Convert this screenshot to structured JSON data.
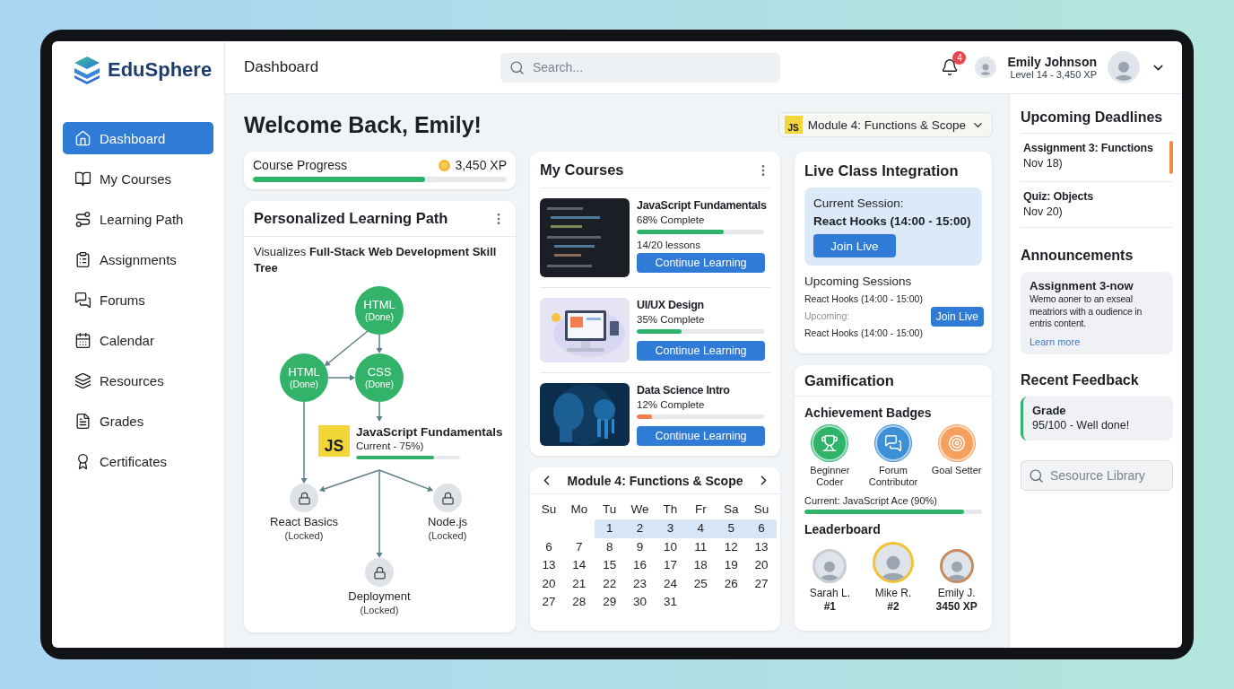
{
  "sidebar": {
    "logo": "EduSphere",
    "items": [
      {
        "label": "Dashboard",
        "selected": true
      },
      {
        "label": "My Courses",
        "selected": false
      },
      {
        "label": "Learning Path",
        "selected": false
      },
      {
        "label": "Assignments",
        "selected": false
      },
      {
        "label": "Forums",
        "selected": false
      },
      {
        "label": "Calendar",
        "selected": false
      },
      {
        "label": "Resources",
        "selected": false
      },
      {
        "label": "Grades",
        "selected": false
      },
      {
        "label": "Certificates",
        "selected": false
      }
    ]
  },
  "topbar": {
    "title": "Dashboard",
    "search": {
      "placeholder": "Search..."
    },
    "notifications": "4",
    "user": {
      "name": "Emily Johnson",
      "level": "Level 14 - 3,450 XP"
    }
  },
  "welcome": "Welcome Back, Emily!",
  "module_selector": {
    "badge": "JS",
    "label": "Module 4: Functions & Scope"
  },
  "course_progress": {
    "label": "Course Progress",
    "xp": "3,450 XP",
    "level": 0.68
  },
  "learning_path": {
    "title": "Personalized Learning Path",
    "description": "Visualizes **Full-Stack Web Development Skill Tree**",
    "nodes": [
      {
        "kind": "done",
        "label": "HTML",
        "status": "(Done)"
      },
      {
        "kind": "done",
        "label": "HTML",
        "status": "(Done)"
      },
      {
        "kind": "done",
        "label": "CSS",
        "status": "(Done)"
      },
      {
        "kind": "current",
        "badge": "JS",
        "label": "JavaScript Fundamentals",
        "status": "Current - 75%)",
        "level": 0.75
      },
      {
        "kind": "locked",
        "label": "React Basics",
        "status": "(Locked)"
      },
      {
        "kind": "locked",
        "label": "Node.js",
        "status": "(Locked)"
      },
      {
        "kind": "locked",
        "label": "Deployment",
        "status": "(Locked)"
      }
    ]
  },
  "my_courses": {
    "title": "My Courses",
    "courses": [
      {
        "title": "JavaScript Fundamentals",
        "progress": "68% Complete",
        "level": 0.68,
        "color": "#2fb36b",
        "lessons": "14/20 lessons",
        "button": "Continue Learning"
      },
      {
        "title": "UI/UX Design",
        "progress": "35% Complete",
        "level": 0.35,
        "color": "#2fb36b",
        "button": "Continue Learning"
      },
      {
        "title": "Data Science Intro",
        "progress": "12% Complete",
        "level": 0.12,
        "color": "#f07f4f",
        "button": "Continue Learning"
      }
    ]
  },
  "calendar": {
    "title": "Module 4: Functions & Scope",
    "weekdays": [
      "Su",
      "Mo",
      "Tu",
      "We",
      "Th",
      "Fr",
      "Sa",
      "Su"
    ],
    "weeks": [
      {
        "days": [
          "1",
          "2",
          "3",
          "4",
          "5",
          "6"
        ],
        "selected": true
      },
      {
        "days": [
          "6",
          "7",
          "8",
          "9",
          "10",
          "11",
          "12",
          "13"
        ],
        "selected": false
      },
      {
        "days": [
          "13",
          "14",
          "15",
          "16",
          "17",
          "18",
          "19",
          "20"
        ],
        "selected": false
      },
      {
        "days": [
          "20",
          "21",
          "22",
          "23",
          "24",
          "25",
          "26",
          "27"
        ],
        "selected": false
      },
      {
        "days": [
          "27",
          "28",
          "29",
          "30",
          "31"
        ],
        "selected": false
      }
    ]
  },
  "live_class": {
    "title": "Live Class Integration",
    "current": {
      "label": "Current Session:",
      "session": "React Hooks (14:00 - 15:00)",
      "button": "Join Live"
    },
    "upcoming_title": "Upcoming Sessions",
    "upcoming": [
      {
        "kind": "session",
        "text": "React Hooks (14:00 - 15:00)"
      },
      {
        "kind": "note",
        "text": "Upcoming:"
      },
      {
        "kind": "session",
        "text": "React Hooks (14:00 - 15:00)"
      }
    ],
    "upcoming_button": "Join Live"
  },
  "gamification": {
    "title": "Gamification",
    "badges_title": "Achievement Badges",
    "badges": [
      {
        "label": "Beginner Coder",
        "color": "#2fb36b"
      },
      {
        "label": "Forum Contributor",
        "color": "#3d8fd6"
      },
      {
        "label": "Goal Setter",
        "color": "#f6a060"
      }
    ],
    "current": "Current: JavaScript Ace (90%)",
    "level": 0.9,
    "leaderboard_title": "Leaderboard",
    "leaderboard": [
      {
        "name": "Sarah L.",
        "detail": "#1",
        "color": "#c9ced4"
      },
      {
        "name": "Mike R.",
        "detail": "#2",
        "color": "#f2c230"
      },
      {
        "name": "Emily J.",
        "detail": "3450 XP",
        "color": "#c98a5e"
      }
    ]
  },
  "deadlines": {
    "title": "Upcoming Deadlines",
    "items": [
      {
        "title": "Assignment 3: Functions",
        "date": "Nov 18)",
        "urgent": true
      },
      {
        "title": "Quiz: Objects",
        "date": "Nov 20)",
        "urgent": false
      }
    ]
  },
  "announcements": {
    "title": "Announcements",
    "items": [
      {
        "title": "Assignment 3-now",
        "body": "Wemo aoner to an exseal meatriors with a oudience in entris content.",
        "link": "Learn more"
      }
    ]
  },
  "feedback": {
    "title": "Recent Feedback",
    "items": [
      {
        "title": "Grade",
        "body": "95/100 - Well done!"
      }
    ]
  },
  "resource_search": {
    "placeholder": "Sesource Library"
  }
}
